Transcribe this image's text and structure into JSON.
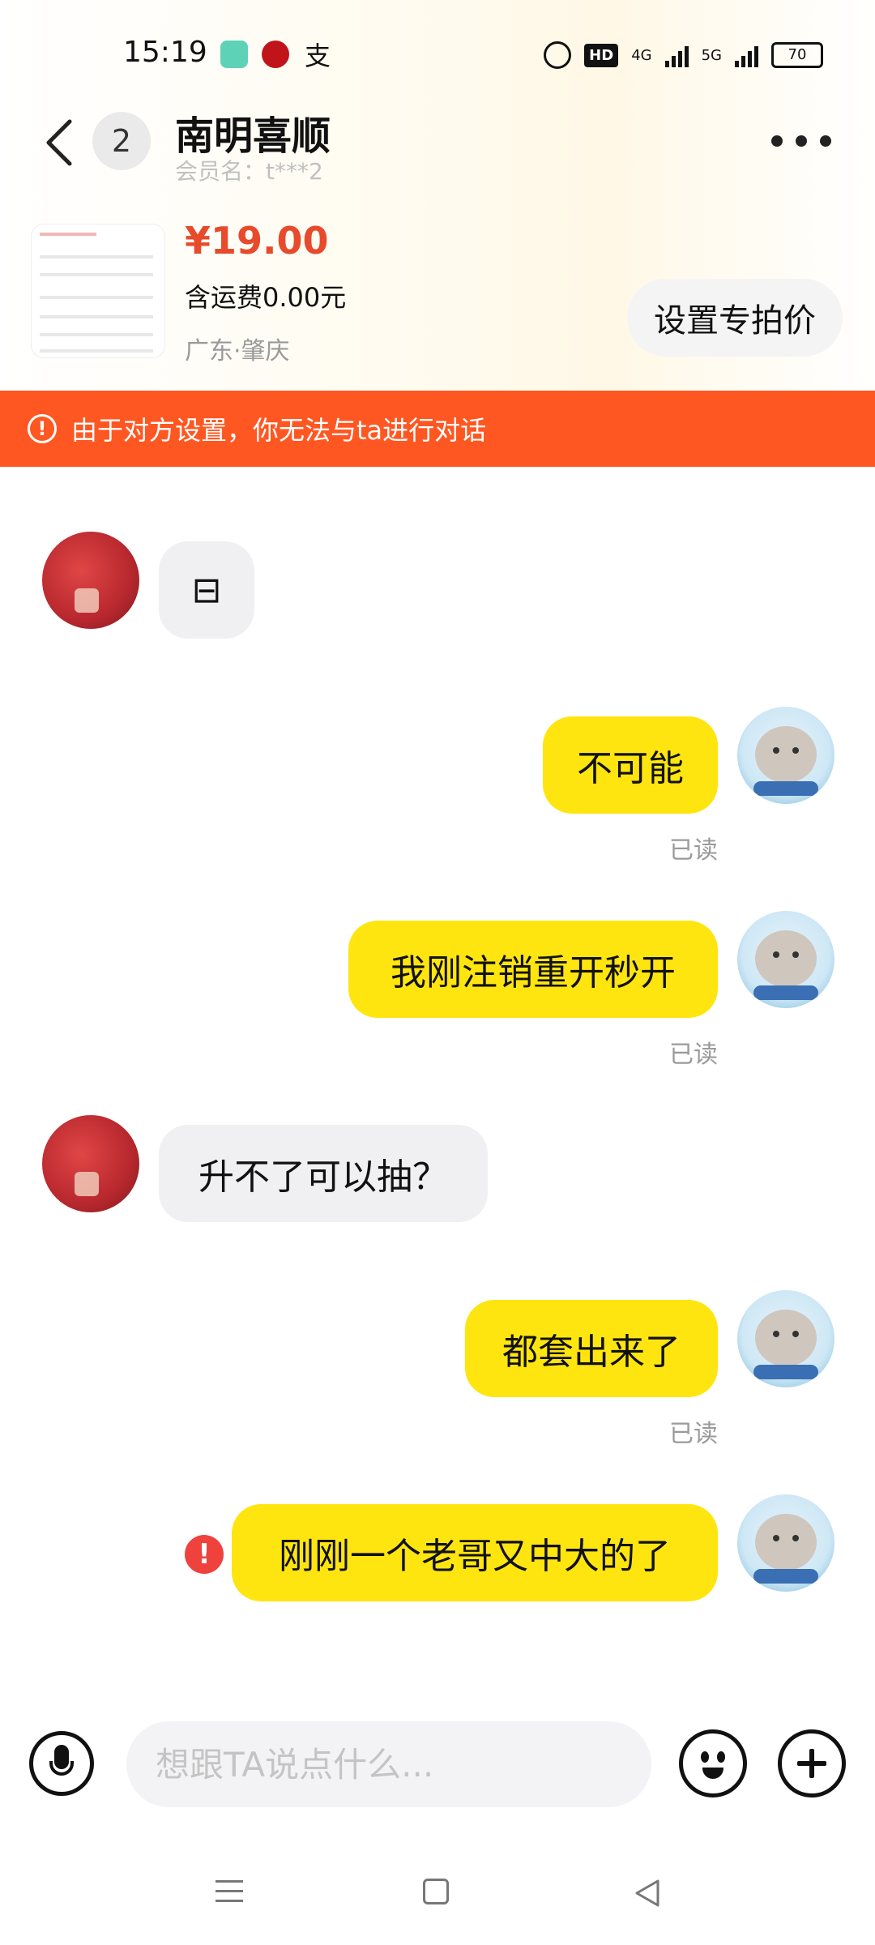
{
  "status_bar": {
    "time": "15:19",
    "app3_glyph": "支",
    "hd_label": "HD",
    "network_1": "4G",
    "network_2": "5G",
    "battery": "70"
  },
  "header": {
    "back_icon": "chevron-left-icon",
    "unread_count": "2",
    "shop_name": "南明喜顺",
    "member_name": "会员名：t***2",
    "more_icon": "more-dots-icon"
  },
  "product": {
    "price": "¥19.00",
    "shipping": "含运费0.00元",
    "location": "广东·肇庆",
    "set_price_label": "设置专拍价"
  },
  "warning": {
    "icon": "warning-circle-icon",
    "text": "由于对方设置，你无法与ta进行对话"
  },
  "messages": [
    {
      "sender": "seller",
      "text": "⊟"
    },
    {
      "sender": "me",
      "text": "不可能",
      "status": "已读"
    },
    {
      "sender": "me",
      "text": "我刚注销重开秒开",
      "status": "已读"
    },
    {
      "sender": "seller",
      "text": "升不了可以抽？"
    },
    {
      "sender": "me",
      "text": "都套出来了",
      "status": "已读"
    },
    {
      "sender": "me",
      "text": "刚刚一个老哥又中大的了",
      "status_icon": "send-failed-icon"
    }
  ],
  "input_bar": {
    "placeholder": "想跟TA说点什么...",
    "voice_icon": "microphone-icon",
    "emoji_icon": "emoji-icon",
    "plus_icon": "plus-icon"
  },
  "colors": {
    "accent_price": "#e84a2c",
    "warning_bg": "#ff5722",
    "bubble_out": "#ffe50f",
    "bubble_in": "#f0f0f2",
    "fail_red": "#f0423c"
  }
}
